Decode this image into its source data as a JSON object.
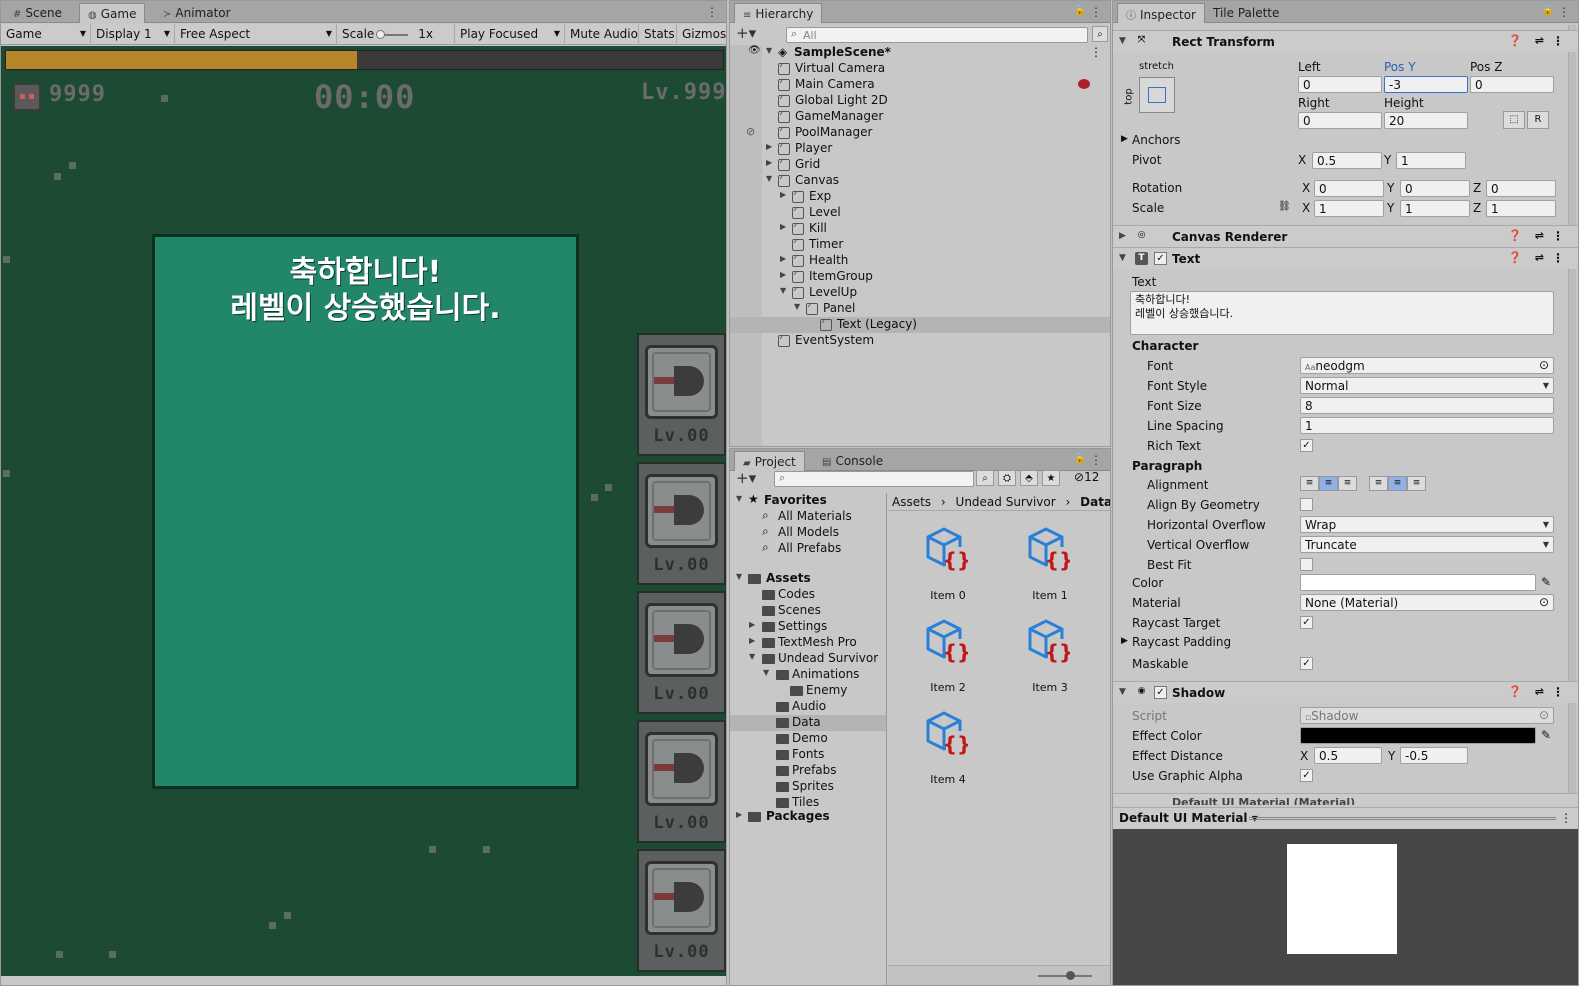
{
  "game_panel": {
    "tabs": [
      {
        "label": "Scene",
        "icon": "grid-icon"
      },
      {
        "label": "Game",
        "icon": "gamepad-icon"
      },
      {
        "label": "Animator",
        "icon": "animator-icon"
      }
    ],
    "toolbar": {
      "mode": "Game",
      "display": "Display 1",
      "aspect": "Free Aspect",
      "scale_label": "Scale",
      "scale_value": "1x",
      "play_mode": "Play Focused",
      "mute": "Mute Audio",
      "stats": "Stats",
      "gizmos": "Gizmos"
    },
    "view": {
      "exp_progress": 0.49,
      "kills": "9999",
      "timer": "00:00",
      "level": "Lv.999",
      "panel_line1": "축하합니다!",
      "panel_line2": "레벨이 상승했습니다.",
      "slots": [
        {
          "label": "Lv.00"
        },
        {
          "label": "Lv.00"
        },
        {
          "label": "Lv.00"
        },
        {
          "label": "Lv.00"
        },
        {
          "label": "Lv.00"
        }
      ]
    }
  },
  "hierarchy": {
    "title": "Hierarchy",
    "search_placeholder": "All",
    "scene": "SampleScene*",
    "items": [
      {
        "label": "Virtual Camera",
        "depth": 1
      },
      {
        "label": "Main Camera",
        "depth": 1
      },
      {
        "label": "Global Light 2D",
        "depth": 1
      },
      {
        "label": "GameManager",
        "depth": 1
      },
      {
        "label": "PoolManager",
        "depth": 1
      },
      {
        "label": "Player",
        "depth": 1,
        "arrow": "▶"
      },
      {
        "label": "Grid",
        "depth": 1,
        "arrow": "▶"
      },
      {
        "label": "Canvas",
        "depth": 1,
        "arrow": "▼"
      },
      {
        "label": "Exp",
        "depth": 2,
        "arrow": "▶"
      },
      {
        "label": "Level",
        "depth": 2
      },
      {
        "label": "Kill",
        "depth": 2,
        "arrow": "▶"
      },
      {
        "label": "Timer",
        "depth": 2
      },
      {
        "label": "Health",
        "depth": 2,
        "arrow": "▶"
      },
      {
        "label": "ItemGroup",
        "depth": 2,
        "arrow": "▶"
      },
      {
        "label": "LevelUp",
        "depth": 2,
        "arrow": "▼"
      },
      {
        "label": "Panel",
        "depth": 3,
        "arrow": "▼"
      },
      {
        "label": "Text (Legacy)",
        "depth": 4,
        "selected": true
      },
      {
        "label": "EventSystem",
        "depth": 1
      }
    ]
  },
  "project": {
    "tabs": [
      {
        "label": "Project",
        "icon": "folder-icon"
      },
      {
        "label": "Console",
        "icon": "console-icon"
      }
    ],
    "hidden_count": "12",
    "favorites_label": "Favorites",
    "favorites": [
      "All Materials",
      "All Models",
      "All Prefabs"
    ],
    "assets_label": "Assets",
    "tree": [
      {
        "label": "Codes",
        "depth": 1
      },
      {
        "label": "Scenes",
        "depth": 1
      },
      {
        "label": "Settings",
        "depth": 1,
        "arrow": "▶"
      },
      {
        "label": "TextMesh Pro",
        "depth": 1,
        "arrow": "▶"
      },
      {
        "label": "Undead Survivor",
        "depth": 1,
        "arrow": "▼"
      },
      {
        "label": "Animations",
        "depth": 2,
        "arrow": "▼"
      },
      {
        "label": "Enemy",
        "depth": 3
      },
      {
        "label": "Audio",
        "depth": 2
      },
      {
        "label": "Data",
        "depth": 2,
        "selected": true
      },
      {
        "label": "Demo",
        "depth": 2
      },
      {
        "label": "Fonts",
        "depth": 2
      },
      {
        "label": "Prefabs",
        "depth": 2
      },
      {
        "label": "Sprites",
        "depth": 2
      },
      {
        "label": "Tiles",
        "depth": 2
      }
    ],
    "packages_label": "Packages",
    "breadcrumb": [
      "Assets",
      "Undead Survivor",
      "Data"
    ],
    "assets": [
      {
        "label": "Item 0"
      },
      {
        "label": "Item 1"
      },
      {
        "label": "Item 2"
      },
      {
        "label": "Item 3"
      },
      {
        "label": "Item 4"
      }
    ]
  },
  "inspector": {
    "tabs": [
      {
        "label": "Inspector",
        "icon": "info-icon"
      },
      {
        "label": "Tile Palette"
      }
    ],
    "rect_transform": {
      "title": "Rect Transform",
      "anchor_h": "stretch",
      "anchor_v": "top",
      "left_label": "Left",
      "left": "0",
      "posy_label": "Pos Y",
      "posy": "-3",
      "posz_label": "Pos Z",
      "posz": "0",
      "right_label": "Right",
      "right": "0",
      "height_label": "Height",
      "height": "20",
      "anchors": "Anchors",
      "pivot": "Pivot",
      "pivot_x": "0.5",
      "pivot_y": "1",
      "rotation": "Rotation",
      "rot_x": "0",
      "rot_y": "0",
      "rot_z": "0",
      "scale": "Scale",
      "scale_x": "1",
      "scale_y": "1",
      "scale_z": "1"
    },
    "canvas_renderer": "Canvas Renderer",
    "text_comp": {
      "title": "Text",
      "text_label": "Text",
      "text_line1": "축하합니다!",
      "text_line2": "레벨이 상승했습니다.",
      "character": "Character",
      "font_label": "Font",
      "font": "neodgm",
      "font_style_label": "Font Style",
      "font_style": "Normal",
      "font_size_label": "Font Size",
      "font_size": "8",
      "line_spacing_label": "Line Spacing",
      "line_spacing": "1",
      "rich_text_label": "Rich Text",
      "paragraph": "Paragraph",
      "alignment_label": "Alignment",
      "align_geo_label": "Align By Geometry",
      "h_overflow_label": "Horizontal Overflow",
      "h_overflow": "Wrap",
      "v_overflow_label": "Vertical Overflow",
      "v_overflow": "Truncate",
      "best_fit_label": "Best Fit",
      "color_label": "Color",
      "material_label": "Material",
      "material": "None (Material)",
      "raycast_label": "Raycast Target",
      "raycast_pad_label": "Raycast Padding",
      "maskable_label": "Maskable"
    },
    "shadow": {
      "title": "Shadow",
      "script_label": "Script",
      "script": "Shadow",
      "effect_color_label": "Effect Color",
      "effect_distance_label": "Effect Distance",
      "dist_x": "0.5",
      "dist_y": "-0.5",
      "use_alpha_label": "Use Graphic Alpha"
    },
    "cut_off_label": "Default UI Material (Material)",
    "preview_label": "Default UI Material"
  }
}
